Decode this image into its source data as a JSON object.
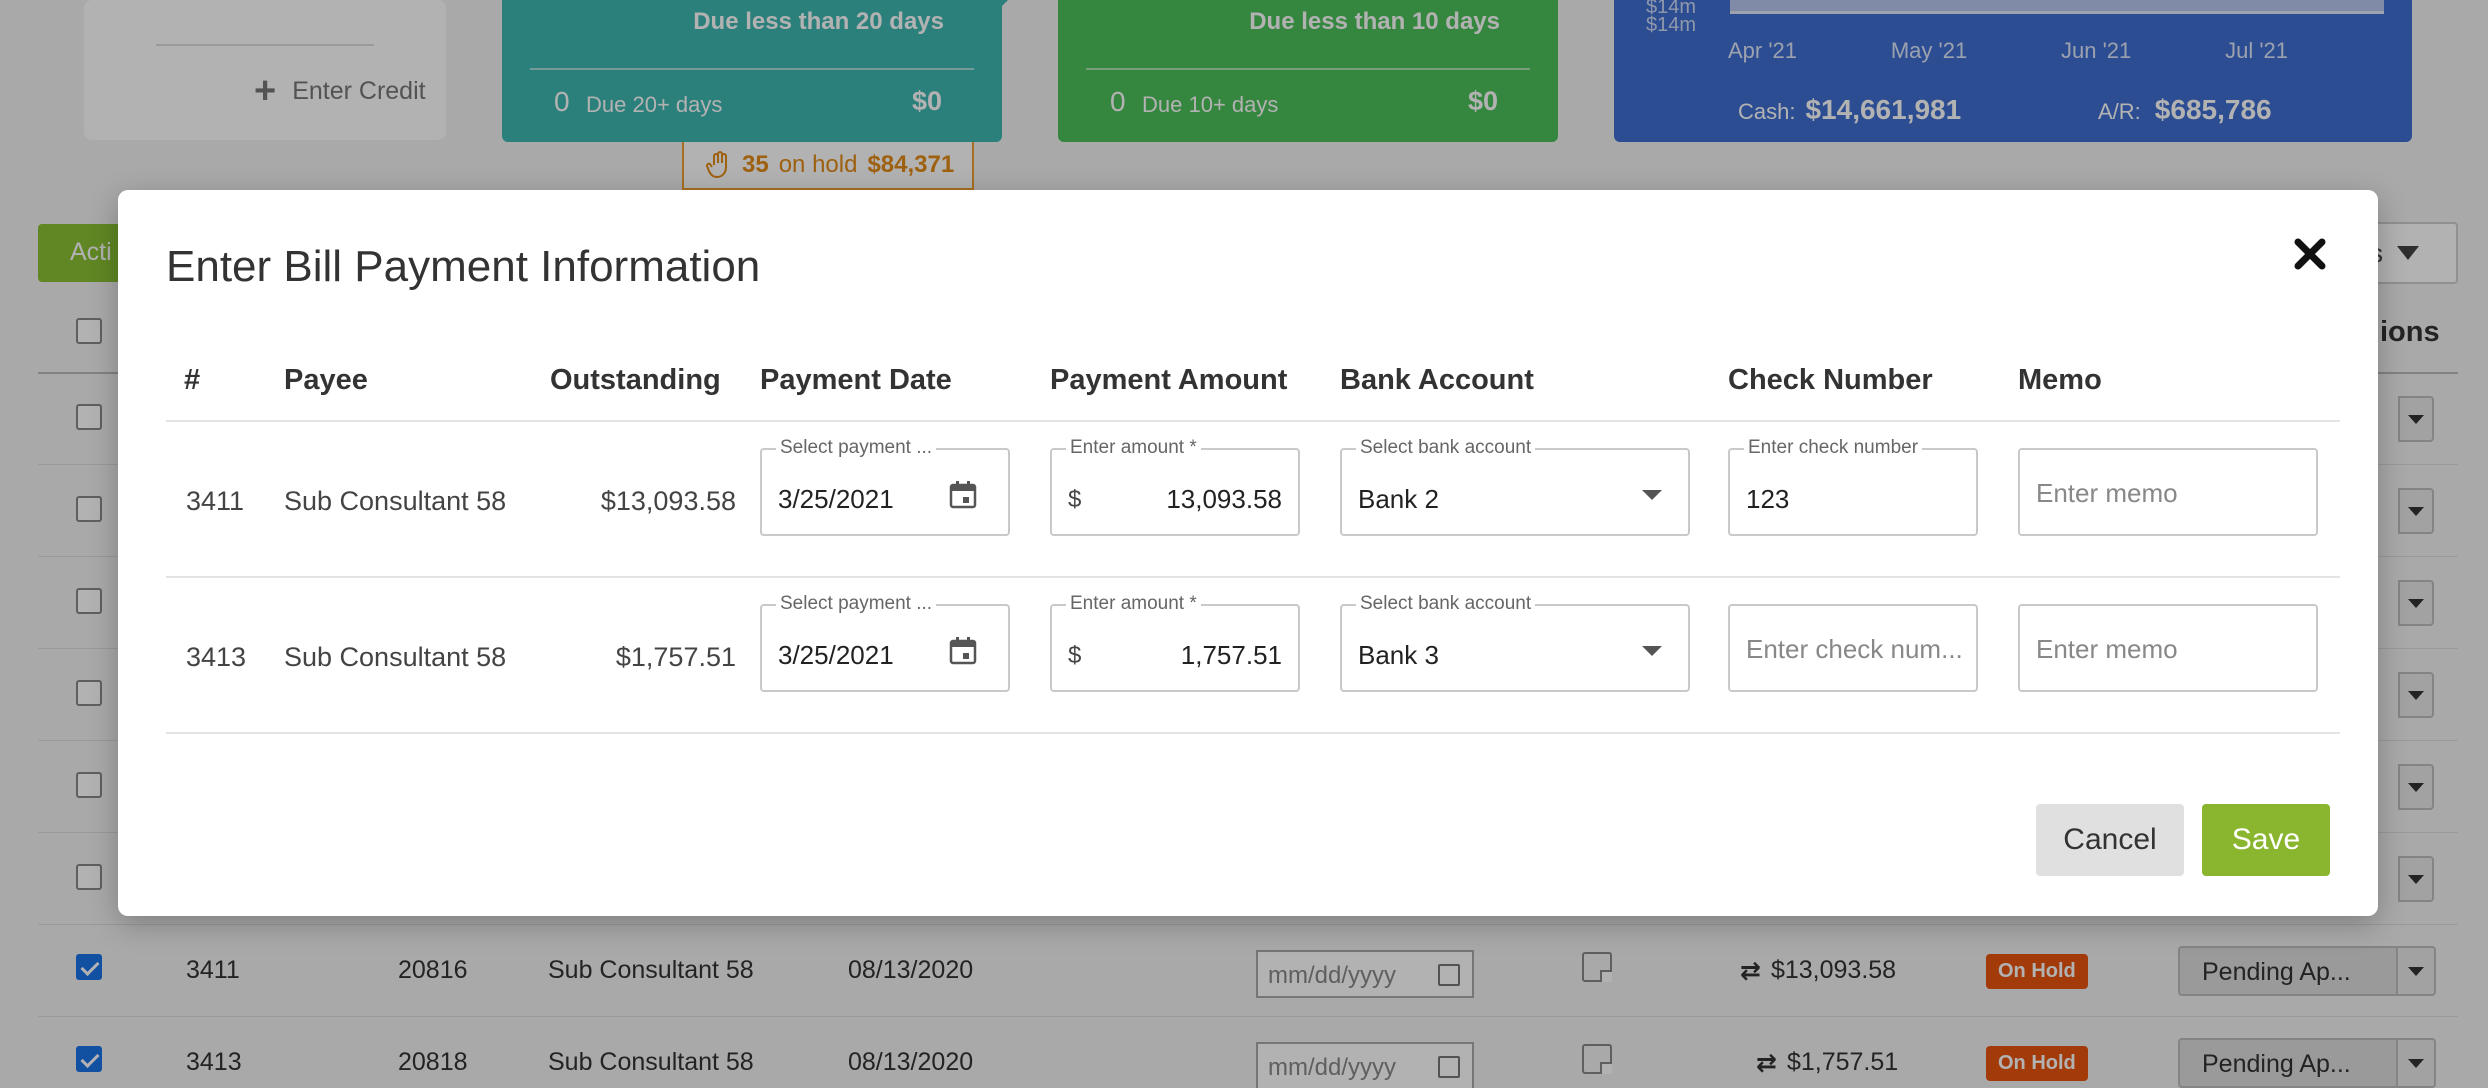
{
  "background": {
    "credit_card": {
      "label": "Enter Credit",
      "icon": "plus-icon"
    },
    "due_cards": [
      {
        "heading": "Due less than 20 days",
        "count": "0",
        "label": "Due 20+ days",
        "amount": "$0",
        "color": "#3fb8b2"
      },
      {
        "heading": "Due less than 10 days",
        "count": "0",
        "label": "Due 10+ days",
        "amount": "$0",
        "color": "#4cc05b"
      }
    ],
    "on_hold": {
      "icon": "hand-icon",
      "count": "35",
      "label": "on hold",
      "amount": "$84,371"
    },
    "cash_card": {
      "y_labels": [
        "$14m",
        "$14m"
      ],
      "months": [
        "Apr '21",
        "May '21",
        "Jun '21",
        "Jul '21"
      ],
      "cash_label": "Cash:",
      "cash_value": "$14,661,981",
      "ar_label": "A/R:",
      "ar_value": "$685,786",
      "color": "#3f6fd1"
    },
    "actions_label": "Acti",
    "filters_label": "s",
    "actions_col_label": "ions",
    "rows": [
      {
        "id": "3411",
        "ref": "20816",
        "payee": "Sub Consultant 58",
        "date": "08/13/2020",
        "date_placeholder": "mm/dd/yyyy",
        "amount": "$13,093.58",
        "badge": "On Hold",
        "status": "Pending Ap..."
      },
      {
        "id": "3413",
        "ref": "20818",
        "payee": "Sub Consultant 58",
        "date": "08/13/2020",
        "date_placeholder": "mm/dd/yyyy",
        "amount": "$1,757.51",
        "badge": "On Hold",
        "status": "Pending Ap..."
      }
    ],
    "arrow_glyph": "⇄"
  },
  "modal": {
    "title": "Enter Bill Payment Information",
    "columns": [
      "#",
      "Payee",
      "Outstanding",
      "Payment Date",
      "Payment Amount",
      "Bank Account",
      "Check Number",
      "Memo"
    ],
    "rows": [
      {
        "id": "3411",
        "payee": "Sub Consultant 58",
        "outstanding": "$13,093.58",
        "date_label": "Select payment ...",
        "date_value": "3/25/2021",
        "amount_label": "Enter amount *",
        "currency": "$",
        "amount_value": "13,093.58",
        "bank_label": "Select bank account",
        "bank_value": "Bank 2",
        "check_label": "Enter check number",
        "check_value": "123",
        "memo_placeholder": "Enter memo"
      },
      {
        "id": "3413",
        "payee": "Sub Consultant 58",
        "outstanding": "$1,757.51",
        "date_label": "Select payment ...",
        "date_value": "3/25/2021",
        "amount_label": "Enter amount *",
        "currency": "$",
        "amount_value": "1,757.51",
        "bank_label": "Select bank account",
        "bank_value": "Bank 3",
        "check_placeholder": "Enter check num...",
        "memo_placeholder": "Enter memo"
      }
    ],
    "cancel_label": "Cancel",
    "save_label": "Save",
    "accent_color": "#8ab52f"
  }
}
